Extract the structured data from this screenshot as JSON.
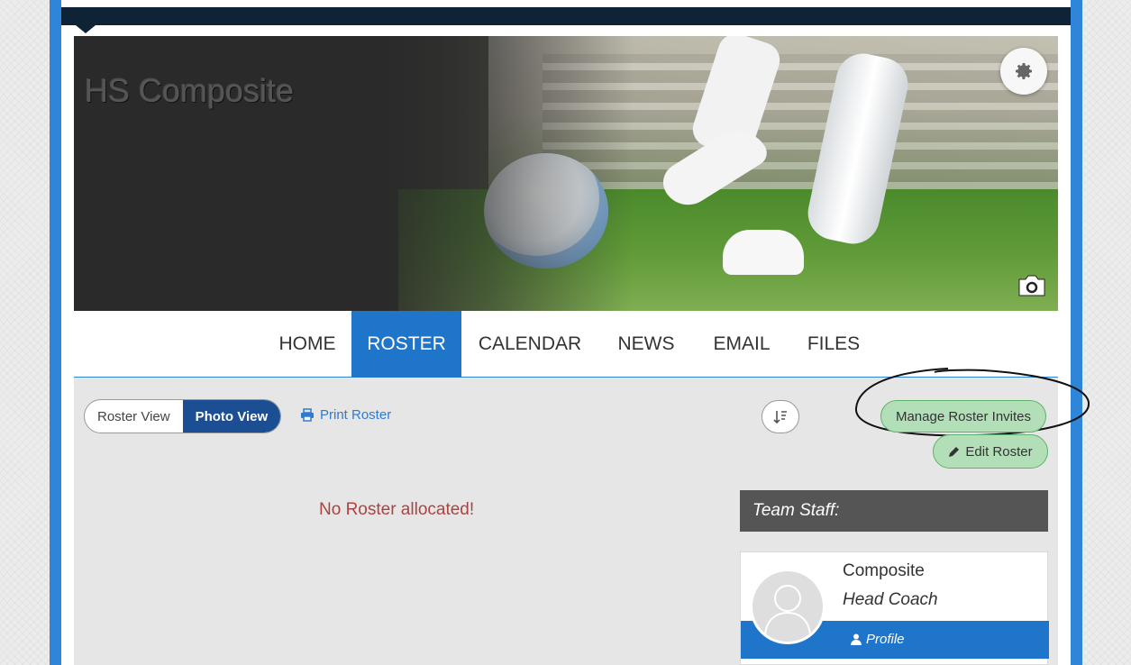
{
  "team": {
    "name": "HS Composite"
  },
  "nav": {
    "items": [
      {
        "label": "HOME"
      },
      {
        "label": "ROSTER"
      },
      {
        "label": "CALENDAR"
      },
      {
        "label": "NEWS"
      },
      {
        "label": "EMAIL"
      },
      {
        "label": "FILES"
      }
    ],
    "active": "ROSTER"
  },
  "toolbar": {
    "view_options": [
      "Roster View",
      "Photo View"
    ],
    "selected_view": "Photo View",
    "print_label": "Print Roster",
    "manage_invites_label": "Manage Roster Invites",
    "edit_roster_label": "Edit Roster"
  },
  "roster": {
    "empty_message": "No Roster allocated!"
  },
  "staff": {
    "header": "Team Staff:",
    "members": [
      {
        "name": "Composite",
        "role": "Head Coach",
        "profile_label": "Profile"
      }
    ]
  },
  "colors": {
    "accent_blue": "#1f75c9",
    "frame_blue": "#2f86d8",
    "dark_navy": "#0f2337",
    "button_green": "#b2dfb8",
    "error_red": "#a94442"
  },
  "icons": {
    "settings": "gear-icon",
    "cover_photo": "camera-icon",
    "print": "printer-icon",
    "sort": "sort-icon",
    "edit": "pencil-icon",
    "profile": "user-icon"
  }
}
